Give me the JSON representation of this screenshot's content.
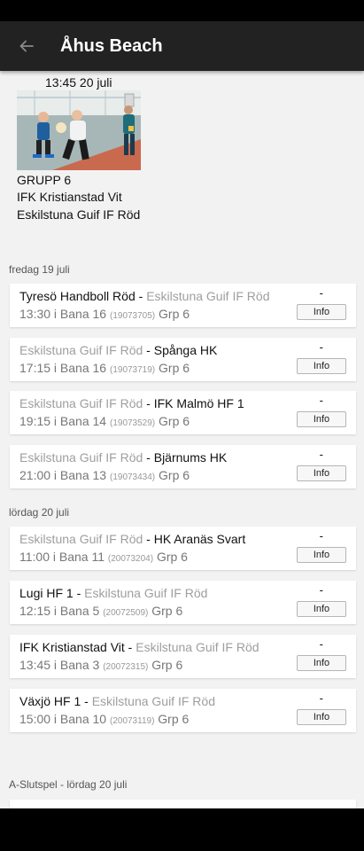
{
  "app_bar": {
    "title": "Åhus Beach"
  },
  "featured_match": {
    "time": "13:45 20 juli",
    "group": "GRUPP 6",
    "team_home": "IFK Kristianstad Vit",
    "team_away": "Eskilstuna Guif IF Röd"
  },
  "sections": [
    {
      "label": "fredag 19 juli",
      "matches": [
        {
          "home": "Tyresö Handboll Röd",
          "sep": " - ",
          "away": "Eskilstuna Guif IF Röd",
          "highlight": "home",
          "time_court": "13:30 i Bana 16 ",
          "id": "(19073705)",
          "group": " Grp 6",
          "score": "-",
          "button": "Info"
        },
        {
          "home": "Eskilstuna Guif IF Röd",
          "sep": " - ",
          "away": "Spånga HK",
          "highlight": "away",
          "time_court": "17:15 i Bana 16 ",
          "id": "(19073719)",
          "group": " Grp 6",
          "score": "-",
          "button": "Info"
        },
        {
          "home": "Eskilstuna Guif IF Röd",
          "sep": " - ",
          "away": "IFK Malmö HF 1",
          "highlight": "away",
          "time_court": "19:15 i Bana 14 ",
          "id": "(19073529)",
          "group": " Grp 6",
          "score": "-",
          "button": "Info"
        },
        {
          "home": "Eskilstuna Guif IF Röd",
          "sep": " - ",
          "away": "Bjärnums HK",
          "highlight": "away",
          "time_court": "21:00 i Bana 13 ",
          "id": "(19073434)",
          "group": " Grp 6",
          "score": "-",
          "button": "Info"
        }
      ]
    },
    {
      "label": "lördag 20 juli",
      "matches": [
        {
          "home": "Eskilstuna Guif IF Röd",
          "sep": " - ",
          "away": "HK Aranäs Svart",
          "highlight": "away",
          "time_court": "11:00 i Bana 11 ",
          "id": "(20073204)",
          "group": " Grp 6",
          "score": "-",
          "button": "Info"
        },
        {
          "home": "Lugi HF 1",
          "sep": " - ",
          "away": "Eskilstuna Guif IF Röd",
          "highlight": "home",
          "time_court": "12:15 i Bana 5 ",
          "id": "(20072509)",
          "group": " Grp 6",
          "score": "-",
          "button": "Info"
        },
        {
          "home": "IFK Kristianstad Vit",
          "sep": " - ",
          "away": "Eskilstuna Guif IF Röd",
          "highlight": "home",
          "time_court": "13:45 i Bana 3 ",
          "id": "(20072315)",
          "group": " Grp 6",
          "score": "-",
          "button": "Info"
        },
        {
          "home": "Växjö HF 1",
          "sep": " - ",
          "away": "Eskilstuna Guif IF Röd",
          "highlight": "home",
          "time_court": "15:00 i Bana 10 ",
          "id": "(20073119)",
          "group": " Grp 6",
          "score": "-",
          "button": "Info"
        }
      ]
    },
    {
      "label": "A-Slutspel - lördag 20 juli",
      "matches": []
    }
  ]
}
